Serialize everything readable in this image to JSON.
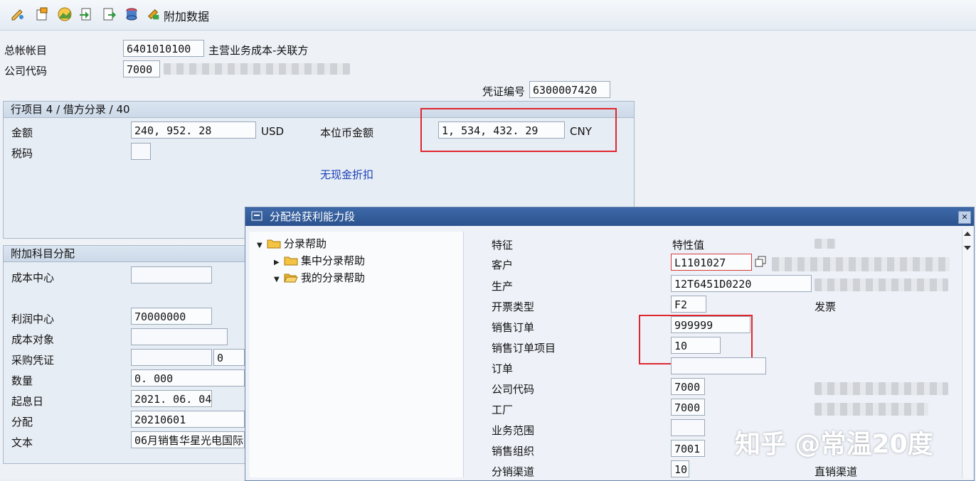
{
  "toolbar": {
    "icons": [
      "edit-icon",
      "screen-variant-icon",
      "landscape-icon",
      "import-icon",
      "export-icon",
      "database-icon"
    ],
    "additional_data_label": "附加数据"
  },
  "header": {
    "gl_account_label": "总帐帐目",
    "gl_account_value": "6401010100",
    "gl_account_desc": "主营业务成本-关联方",
    "company_code_label": "公司代码",
    "company_code_value": "7000",
    "doc_no_label": "凭证编号",
    "doc_no_value": "6300007420"
  },
  "line_item": {
    "title": "行项目 4 / 借方分录 / 40",
    "amount_label": "金额",
    "amount_value": "240, 952. 28",
    "amount_currency": "USD",
    "local_amount_label": "本位币金额",
    "local_amount_value": "1, 534, 432. 29",
    "local_currency": "CNY",
    "tax_code_label": "税码",
    "no_discount_link": "无现金折扣"
  },
  "assignment": {
    "title": "附加科目分配",
    "cost_center_label": "成本中心",
    "profit_center_label": "利润中心",
    "profit_center_value": "70000000",
    "cost_object_label": "成本对象",
    "purchase_doc_label": "采购凭证",
    "purchase_doc_item": "0",
    "quantity_label": "数量",
    "quantity_value": "0. 000",
    "value_date_label": "起息日",
    "value_date_value": "2021. 06. 04",
    "allocation_label": "分配",
    "allocation_value": "20210601",
    "text_label": "文本",
    "text_value": "06月销售华星光电国际"
  },
  "dialog": {
    "title": "分配给获利能力段",
    "tree": {
      "root": "分录帮助",
      "child1": "集中分录帮助",
      "child2": "我的分录帮助"
    },
    "col_characteristic": "特征",
    "col_value": "特性值",
    "rows": [
      {
        "label": "客户",
        "value": "L1101027",
        "desc": ""
      },
      {
        "label": "生产",
        "value": "12T6451D0220",
        "desc": ""
      },
      {
        "label": "开票类型",
        "value": "F2",
        "desc": "发票"
      },
      {
        "label": "销售订单",
        "value": "999999",
        "desc": ""
      },
      {
        "label": "销售订单项目",
        "value": "10",
        "desc": ""
      },
      {
        "label": "订单",
        "value": "",
        "desc": ""
      },
      {
        "label": "公司代码",
        "value": "7000",
        "desc": ""
      },
      {
        "label": "工厂",
        "value": "7000",
        "desc": ""
      },
      {
        "label": "业务范围",
        "value": "",
        "desc": ""
      },
      {
        "label": "销售组织",
        "value": "7001",
        "desc": ""
      },
      {
        "label": "分销渠道",
        "value": "10",
        "desc": "直销渠道"
      }
    ]
  },
  "watermark": "知乎 @常温20度",
  "colors": {
    "highlight": "#e0262e",
    "title_bar": "#2b528e",
    "link": "#1a3fb8"
  }
}
